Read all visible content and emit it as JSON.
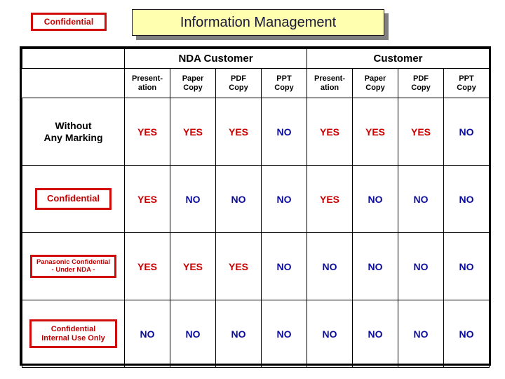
{
  "header": {
    "confidential_badge": "Confidential",
    "title": "Information Management"
  },
  "matrix": {
    "corner_label": "",
    "groups": [
      {
        "label": "NDA Customer",
        "span": 4
      },
      {
        "label": "Customer",
        "span": 4
      }
    ],
    "subheaders": [
      {
        "line1": "Present-",
        "line2": "ation"
      },
      {
        "line1": "Paper",
        "line2": "Copy"
      },
      {
        "line1": "PDF",
        "line2": "Copy"
      },
      {
        "line1": "PPT",
        "line2": "Copy"
      },
      {
        "line1": "Present-",
        "line2": "ation"
      },
      {
        "line1": "Paper",
        "line2": "Copy"
      },
      {
        "line1": "PDF",
        "line2": "Copy"
      },
      {
        "line1": "PPT",
        "line2": "Copy"
      }
    ],
    "rows": [
      {
        "label_style": "plain",
        "label_lines": [
          "Without",
          "Any Marking"
        ],
        "values": [
          "YES",
          "YES",
          "YES",
          "NO",
          "YES",
          "YES",
          "YES",
          "NO"
        ]
      },
      {
        "label_style": "boxed-a",
        "label_lines": [
          "Confidential"
        ],
        "values": [
          "YES",
          "NO",
          "NO",
          "NO",
          "YES",
          "NO",
          "NO",
          "NO"
        ]
      },
      {
        "label_style": "boxed-b",
        "label_lines": [
          "Panasonic Confidential",
          "- Under NDA -"
        ],
        "values": [
          "YES",
          "YES",
          "YES",
          "NO",
          "NO",
          "NO",
          "NO",
          "NO"
        ]
      },
      {
        "label_style": "boxed-c",
        "label_lines": [
          "Confidential",
          "Internal Use Only"
        ],
        "values": [
          "NO",
          "NO",
          "NO",
          "NO",
          "NO",
          "NO",
          "NO",
          "NO"
        ]
      }
    ]
  },
  "colors": {
    "yes": "#cc0000",
    "no": "#0c0c9c",
    "marking_red": "#d10a0a",
    "title_bg": "#ffffaf",
    "title_text": "#17173a",
    "shadow": "#808080"
  }
}
